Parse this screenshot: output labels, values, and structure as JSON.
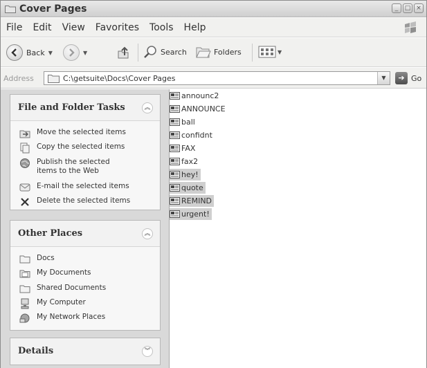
{
  "window": {
    "title": "Cover Pages"
  },
  "menu": [
    "File",
    "Edit",
    "View",
    "Favorites",
    "Tools",
    "Help"
  ],
  "toolbar": {
    "back_label": "Back",
    "search_label": "Search",
    "folders_label": "Folders"
  },
  "address": {
    "label": "Address",
    "path": "C:\\getsuite\\Docs\\Cover Pages",
    "go_label": "Go"
  },
  "file_tasks": {
    "title": "File and Folder Tasks",
    "items": [
      "Move the selected items",
      "Copy the selected items",
      "Publish the selected items to the Web",
      "E-mail the selected items",
      "Delete the selected items"
    ]
  },
  "other_places": {
    "title": "Other Places",
    "items": [
      "Docs",
      "My Documents",
      "Shared Documents",
      "My Computer",
      "My Network Places"
    ]
  },
  "details": {
    "title": "Details"
  },
  "files": [
    {
      "name": "announc2",
      "selected": false
    },
    {
      "name": "ANNOUNCE",
      "selected": false
    },
    {
      "name": "ball",
      "selected": false
    },
    {
      "name": "confidnt",
      "selected": false
    },
    {
      "name": "FAX",
      "selected": false
    },
    {
      "name": "fax2",
      "selected": false
    },
    {
      "name": "hey!",
      "selected": true
    },
    {
      "name": "quote",
      "selected": true
    },
    {
      "name": "REMIND",
      "selected": true
    },
    {
      "name": "urgent!",
      "selected": true
    }
  ],
  "colors": {
    "selection": "#cfcfcf",
    "pane_bg": "#d9d9d9",
    "panel_bg": "#f7f7f7"
  }
}
